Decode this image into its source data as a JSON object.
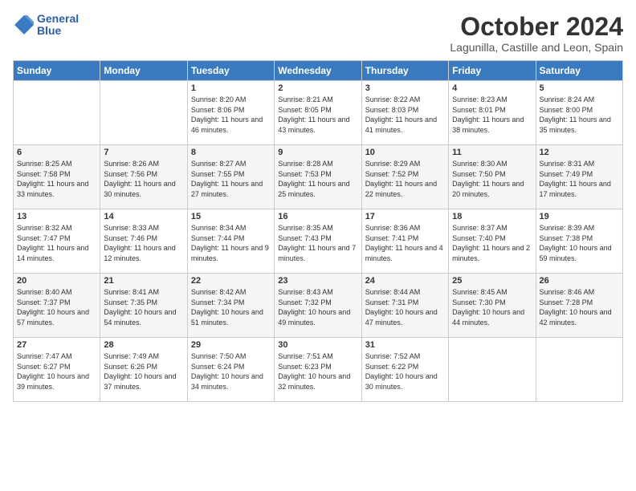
{
  "logo": {
    "line1": "General",
    "line2": "Blue"
  },
  "title": "October 2024",
  "subtitle": "Lagunilla, Castille and Leon, Spain",
  "weekdays": [
    "Sunday",
    "Monday",
    "Tuesday",
    "Wednesday",
    "Thursday",
    "Friday",
    "Saturday"
  ],
  "weeks": [
    [
      {
        "day": "",
        "content": ""
      },
      {
        "day": "",
        "content": ""
      },
      {
        "day": "1",
        "content": "Sunrise: 8:20 AM\nSunset: 8:06 PM\nDaylight: 11 hours and 46 minutes."
      },
      {
        "day": "2",
        "content": "Sunrise: 8:21 AM\nSunset: 8:05 PM\nDaylight: 11 hours and 43 minutes."
      },
      {
        "day": "3",
        "content": "Sunrise: 8:22 AM\nSunset: 8:03 PM\nDaylight: 11 hours and 41 minutes."
      },
      {
        "day": "4",
        "content": "Sunrise: 8:23 AM\nSunset: 8:01 PM\nDaylight: 11 hours and 38 minutes."
      },
      {
        "day": "5",
        "content": "Sunrise: 8:24 AM\nSunset: 8:00 PM\nDaylight: 11 hours and 35 minutes."
      }
    ],
    [
      {
        "day": "6",
        "content": "Sunrise: 8:25 AM\nSunset: 7:58 PM\nDaylight: 11 hours and 33 minutes."
      },
      {
        "day": "7",
        "content": "Sunrise: 8:26 AM\nSunset: 7:56 PM\nDaylight: 11 hours and 30 minutes."
      },
      {
        "day": "8",
        "content": "Sunrise: 8:27 AM\nSunset: 7:55 PM\nDaylight: 11 hours and 27 minutes."
      },
      {
        "day": "9",
        "content": "Sunrise: 8:28 AM\nSunset: 7:53 PM\nDaylight: 11 hours and 25 minutes."
      },
      {
        "day": "10",
        "content": "Sunrise: 8:29 AM\nSunset: 7:52 PM\nDaylight: 11 hours and 22 minutes."
      },
      {
        "day": "11",
        "content": "Sunrise: 8:30 AM\nSunset: 7:50 PM\nDaylight: 11 hours and 20 minutes."
      },
      {
        "day": "12",
        "content": "Sunrise: 8:31 AM\nSunset: 7:49 PM\nDaylight: 11 hours and 17 minutes."
      }
    ],
    [
      {
        "day": "13",
        "content": "Sunrise: 8:32 AM\nSunset: 7:47 PM\nDaylight: 11 hours and 14 minutes."
      },
      {
        "day": "14",
        "content": "Sunrise: 8:33 AM\nSunset: 7:46 PM\nDaylight: 11 hours and 12 minutes."
      },
      {
        "day": "15",
        "content": "Sunrise: 8:34 AM\nSunset: 7:44 PM\nDaylight: 11 hours and 9 minutes."
      },
      {
        "day": "16",
        "content": "Sunrise: 8:35 AM\nSunset: 7:43 PM\nDaylight: 11 hours and 7 minutes."
      },
      {
        "day": "17",
        "content": "Sunrise: 8:36 AM\nSunset: 7:41 PM\nDaylight: 11 hours and 4 minutes."
      },
      {
        "day": "18",
        "content": "Sunrise: 8:37 AM\nSunset: 7:40 PM\nDaylight: 11 hours and 2 minutes."
      },
      {
        "day": "19",
        "content": "Sunrise: 8:39 AM\nSunset: 7:38 PM\nDaylight: 10 hours and 59 minutes."
      }
    ],
    [
      {
        "day": "20",
        "content": "Sunrise: 8:40 AM\nSunset: 7:37 PM\nDaylight: 10 hours and 57 minutes."
      },
      {
        "day": "21",
        "content": "Sunrise: 8:41 AM\nSunset: 7:35 PM\nDaylight: 10 hours and 54 minutes."
      },
      {
        "day": "22",
        "content": "Sunrise: 8:42 AM\nSunset: 7:34 PM\nDaylight: 10 hours and 51 minutes."
      },
      {
        "day": "23",
        "content": "Sunrise: 8:43 AM\nSunset: 7:32 PM\nDaylight: 10 hours and 49 minutes."
      },
      {
        "day": "24",
        "content": "Sunrise: 8:44 AM\nSunset: 7:31 PM\nDaylight: 10 hours and 47 minutes."
      },
      {
        "day": "25",
        "content": "Sunrise: 8:45 AM\nSunset: 7:30 PM\nDaylight: 10 hours and 44 minutes."
      },
      {
        "day": "26",
        "content": "Sunrise: 8:46 AM\nSunset: 7:28 PM\nDaylight: 10 hours and 42 minutes."
      }
    ],
    [
      {
        "day": "27",
        "content": "Sunrise: 7:47 AM\nSunset: 6:27 PM\nDaylight: 10 hours and 39 minutes."
      },
      {
        "day": "28",
        "content": "Sunrise: 7:49 AM\nSunset: 6:26 PM\nDaylight: 10 hours and 37 minutes."
      },
      {
        "day": "29",
        "content": "Sunrise: 7:50 AM\nSunset: 6:24 PM\nDaylight: 10 hours and 34 minutes."
      },
      {
        "day": "30",
        "content": "Sunrise: 7:51 AM\nSunset: 6:23 PM\nDaylight: 10 hours and 32 minutes."
      },
      {
        "day": "31",
        "content": "Sunrise: 7:52 AM\nSunset: 6:22 PM\nDaylight: 10 hours and 30 minutes."
      },
      {
        "day": "",
        "content": ""
      },
      {
        "day": "",
        "content": ""
      }
    ]
  ]
}
